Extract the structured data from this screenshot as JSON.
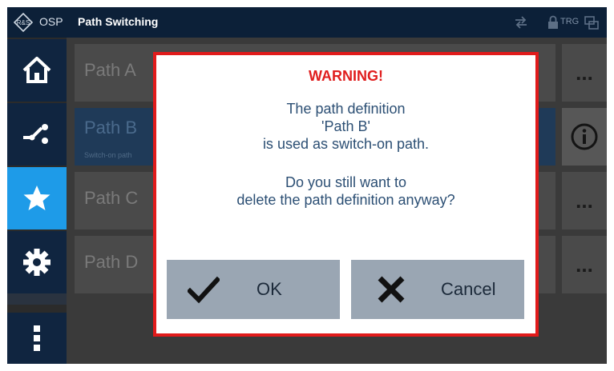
{
  "titlebar": {
    "app_name": "OSP",
    "title": "Path Switching",
    "trg_label": "TRG",
    "icons": [
      "rs-logo-icon",
      "swap-arrows-icon",
      "lock-icon",
      "screen-icon"
    ]
  },
  "sidebar": {
    "items": [
      {
        "name": "home",
        "icon": "home-icon",
        "active": false
      },
      {
        "name": "paths",
        "icon": "switch-path-icon",
        "active": false
      },
      {
        "name": "favorites",
        "icon": "star-icon",
        "active": true
      },
      {
        "name": "settings",
        "icon": "gear-icon",
        "active": false
      },
      {
        "name": "more",
        "icon": "vertical-dots-icon",
        "active": false
      }
    ],
    "active_color": "#1e9be8"
  },
  "paths": [
    {
      "label": "Path A",
      "sub": "",
      "action": "..."
    },
    {
      "label": "Path B",
      "sub": "Switch-on path",
      "action": "info"
    },
    {
      "label": "Path C",
      "sub": "",
      "action": "..."
    },
    {
      "label": "Path D",
      "sub": "",
      "action": "..."
    }
  ],
  "dialog": {
    "title": "WARNING!",
    "lines": [
      "The path definition",
      "'Path B'",
      "is used as switch-on path.",
      "Do you still want to",
      "delete the path definition anyway?"
    ],
    "ok_label": "OK",
    "cancel_label": "Cancel",
    "border_color": "#e11b1b",
    "title_color": "#e01e1e"
  }
}
